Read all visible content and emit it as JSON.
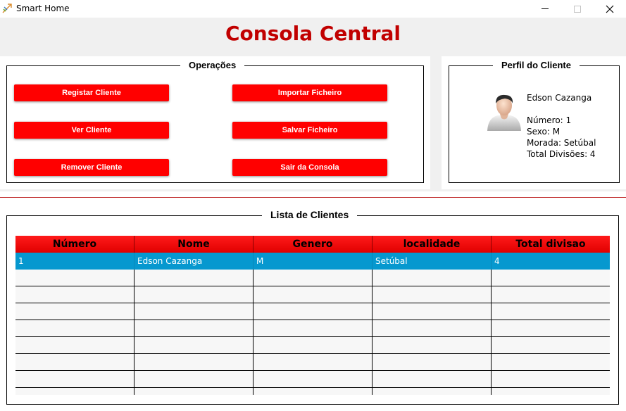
{
  "window": {
    "title": "Smart Home"
  },
  "header": {
    "title": "Consola Central"
  },
  "operations": {
    "legend": "Operações",
    "buttons": {
      "register": "Registar Cliente",
      "view": "Ver Cliente",
      "remove": "Remover Cliente",
      "import": "Importar Ficheiro",
      "save": "Salvar Ficheiro",
      "exit": "Sair da Consola"
    }
  },
  "profile": {
    "legend": "Perfil do Cliente",
    "name": "Edson Cazanga",
    "number": "Número: 1",
    "sex": "Sexo: M",
    "address": "Morada: Setúbal",
    "divisions": "Total Divisões: 4",
    "avatar_icon": "user-avatar-icon"
  },
  "client_list": {
    "legend": "Lista de Clientes",
    "columns": [
      "Número",
      "Nome",
      "Genero",
      "localidade",
      "Total divisao"
    ],
    "rows": [
      [
        "1",
        "Edson Cazanga",
        "M",
        "Setúbal",
        "4"
      ]
    ],
    "empty_rows": 8
  },
  "colors": {
    "accent": "#ff0000",
    "title": "#c10000",
    "selection": "#0698cf"
  }
}
